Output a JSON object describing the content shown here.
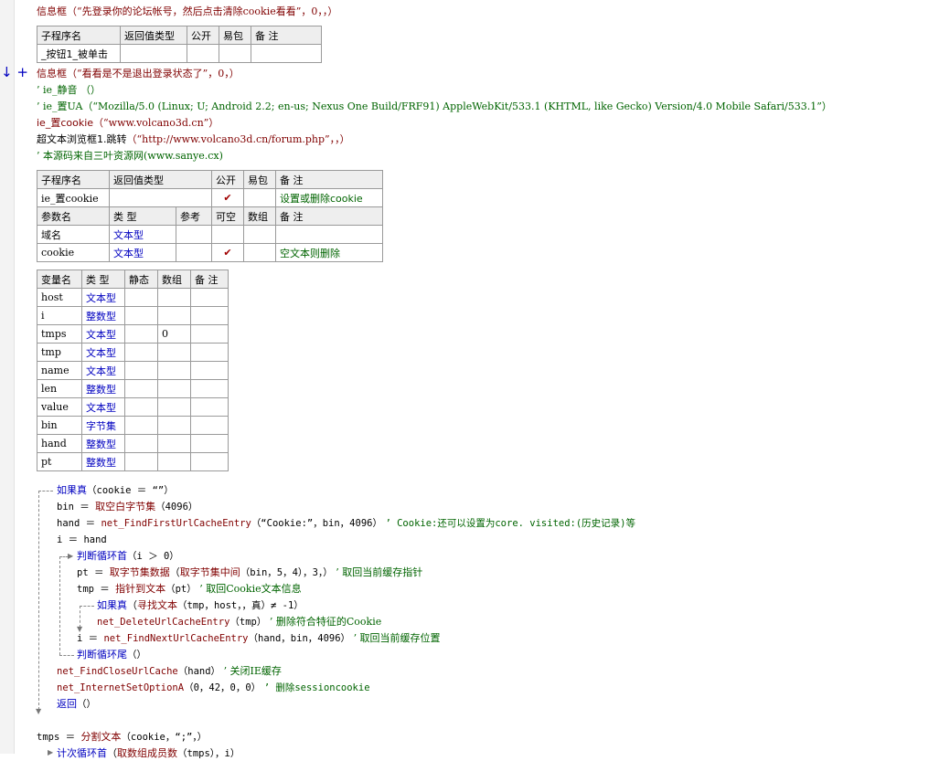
{
  "gutter": {
    "marker": "↓ +"
  },
  "lines": {
    "l1": {
      "fn": "信息框",
      "args": "（“先登录你的论坛帐号，然后点击清除cookie看看”，0，，）"
    },
    "l2": {
      "fn": "信息框",
      "args": "（“看看是不是退出登录状态了”，0，）"
    },
    "l3": {
      "text": "’ ie_静音 （）"
    },
    "l4": {
      "text": "’ ie_置UA（“Mozilla/5.0 (Linux; U; Android 2.2; en-us; Nexus One Build/FRF91) AppleWebKit/533.1 (KHTML, like Gecko) Version/4.0 Mobile Safari/533.1”）"
    },
    "l5": {
      "fn": "ie_置cookie",
      "args": "（“www.volcano3d.cn”）"
    },
    "l6": {
      "fn": "超文本浏览框1.跳转",
      "args": "（“http://www.volcano3d.cn/forum.php”，，）"
    },
    "l7": {
      "text": "’ 本源码来自三叶资源网(www.sanye.cx)"
    }
  },
  "table1": {
    "headers": [
      "子程序名",
      "返回值类型",
      "公开",
      "易包",
      "备 注"
    ],
    "row": [
      "_按钮1_被单击",
      "",
      "",
      "",
      ""
    ]
  },
  "table2": {
    "headers": [
      "子程序名",
      "返回值类型",
      "公开",
      "易包",
      "备 注"
    ],
    "row": {
      "name": "ie_置cookie",
      "ret": "",
      "public": "✔",
      "pkg": "",
      "note": "设置或删除cookie"
    },
    "param_headers": [
      "参数名",
      "类 型",
      "参考",
      "可空",
      "数组",
      "备 注"
    ],
    "params": [
      {
        "name": "域名",
        "type": "文本型",
        "ref": "",
        "nullable": "",
        "array": "",
        "note": ""
      },
      {
        "name": "cookie",
        "type": "文本型",
        "ref": "",
        "nullable": "✔",
        "array": "",
        "note": "空文本则删除"
      }
    ]
  },
  "table3": {
    "headers": [
      "变量名",
      "类 型",
      "静态",
      "数组",
      "备 注"
    ],
    "rows": [
      {
        "name": "host",
        "type": "文本型",
        "static": "",
        "array": "",
        "note": ""
      },
      {
        "name": "i",
        "type": "整数型",
        "static": "",
        "array": "",
        "note": ""
      },
      {
        "name": "tmps",
        "type": "文本型",
        "static": "",
        "array": "0",
        "note": ""
      },
      {
        "name": "tmp",
        "type": "文本型",
        "static": "",
        "array": "",
        "note": ""
      },
      {
        "name": "name",
        "type": "文本型",
        "static": "",
        "array": "",
        "note": ""
      },
      {
        "name": "len",
        "type": "整数型",
        "static": "",
        "array": "",
        "note": ""
      },
      {
        "name": "value",
        "type": "文本型",
        "static": "",
        "array": "",
        "note": ""
      },
      {
        "name": "bin",
        "type": "字节集",
        "static": "",
        "array": "",
        "note": ""
      },
      {
        "name": "hand",
        "type": "整数型",
        "static": "",
        "array": "",
        "note": ""
      },
      {
        "name": "pt",
        "type": "整数型",
        "static": "",
        "array": "",
        "note": ""
      }
    ]
  },
  "code": {
    "c1": {
      "kw": "如果真",
      "rest": "（cookie ＝ “”）"
    },
    "c2": {
      "lhs": "bin ＝ ",
      "fn": "取空白字节集",
      "rest": "（4096）"
    },
    "c3": {
      "lhs": "hand ＝ ",
      "fn": "net_FindFirstUrlCacheEntry",
      "rest": "（“Cookie:”，bin，4096）",
      "cm": "’ Cookie:还可以设置为core. visited:(历史记录)等"
    },
    "c4": {
      "text": "i ＝ hand"
    },
    "c5": {
      "kw": "判断循环首",
      "rest": "（i ＞ 0）"
    },
    "c6": {
      "lhs": "pt ＝ ",
      "fn": "取字节集数据",
      "mid": "（",
      "fn2": "取字节集中间",
      "rest": "（bin，5，4），3，）",
      "cm": "’ 取回当前缓存指针"
    },
    "c7": {
      "lhs": "tmp ＝ ",
      "fn": "指针到文本",
      "rest": "（pt）",
      "cm": "’ 取回Cookie文本信息"
    },
    "c8": {
      "kw": "如果真",
      "mid": "（",
      "fn": "寻找文本",
      "rest": "（tmp，host，，真）≠ -1）"
    },
    "c9": {
      "fn": "net_DeleteUrlCacheEntry",
      "rest": "（tmp）",
      "cm": "’ 删除符合特征的Cookie"
    },
    "c10": {
      "lhs": "i ＝ ",
      "fn": "net_FindNextUrlCacheEntry",
      "rest": "（hand，bin，4096）",
      "cm": "’ 取回当前缓存位置"
    },
    "c11": {
      "kw": "判断循环尾",
      "rest": "（）"
    },
    "c12": {
      "fn": "net_FindCloseUrlCache",
      "rest": "（hand）",
      "cm": "’ 关闭IE缓存"
    },
    "c13": {
      "fn": "net_InternetSetOptionA",
      "rest": "（0，42，0，0）",
      "cm": "’ 删除sessioncookie"
    },
    "c14": {
      "kw": "返回",
      "rest": "（）"
    },
    "c15": {
      "lhs": "tmps ＝ ",
      "fn": "分割文本",
      "rest": "（cookie，“;”，）"
    },
    "c16": {
      "kw": "计次循环首",
      "mid": "（",
      "fn": "取数组成员数",
      "rest": "（tmps），i）"
    }
  }
}
